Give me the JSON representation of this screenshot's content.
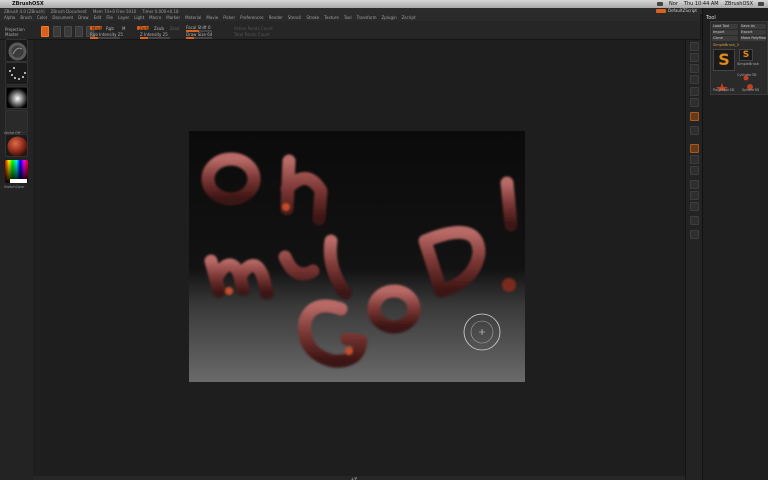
{
  "menubar": {
    "app_name": "ZBrushOSX",
    "status_clock": "Thu 10:44 AM",
    "right_app": "ZBrushOSX",
    "status_label": "Nor"
  },
  "titlebar": {
    "items": [
      "ZBrush 4.0 [ZBrush]",
      "ZBrush Document",
      "Mem 74+0 Free 5010",
      "Timer 0.000+0.18"
    ]
  },
  "zbrush_menu": {
    "items": [
      "Alpha",
      "Brush",
      "Color",
      "Document",
      "Draw",
      "Edit",
      "File",
      "Layer",
      "Light",
      "Macro",
      "Marker",
      "Material",
      "Movie",
      "Picker",
      "Preferences",
      "Render",
      "Stencil",
      "Stroke",
      "Texture",
      "Tool",
      "Transform",
      "Zplugin",
      "Zscript"
    ],
    "right_items": [
      "Help",
      "Edit",
      "UI"
    ],
    "script_label": "DefaultZScript"
  },
  "toolbar": {
    "projection_master": "Projection Master",
    "mrgb": "Mrgb",
    "rgb": "Rgb",
    "m": "M",
    "zadd": "Zadd",
    "zsub": "Zsub",
    "zcut": "Zcut",
    "focal_shift": "Focal Shift 0",
    "draw_size": "Draw Size 64",
    "rgb_intensity": "Rgb Intensity 25",
    "z_intensity": "Z Intensity 25",
    "active_points": "Active Points Count",
    "total_points": "Total Points Count",
    "rgb_intensity_value": 25,
    "z_intensity_value": 25
  },
  "left_shelf": {
    "labels": [
      "",
      "",
      "",
      "Alpha Off",
      "",
      "SwitchColor"
    ]
  },
  "canvas": {
    "drawn_text": "Oh my GOD!"
  },
  "tool_palette": {
    "title": "Tool",
    "load_tool": "Load Tool",
    "save_as": "Save As",
    "import": "Import",
    "export": "Export",
    "clone": "Clone",
    "make_polymesh": "Make PolyMesh3D",
    "current_tool": "SimpleBrush_3",
    "thumbs": [
      "S",
      "S"
    ],
    "thumb_labels": [
      "SimpleBrush",
      "Cylinder3D",
      "PolyMesh3D",
      "Sphere3D"
    ]
  },
  "colors": {
    "accent": "#d9611a",
    "bg": "#1c1c1c",
    "panel": "#262626"
  }
}
